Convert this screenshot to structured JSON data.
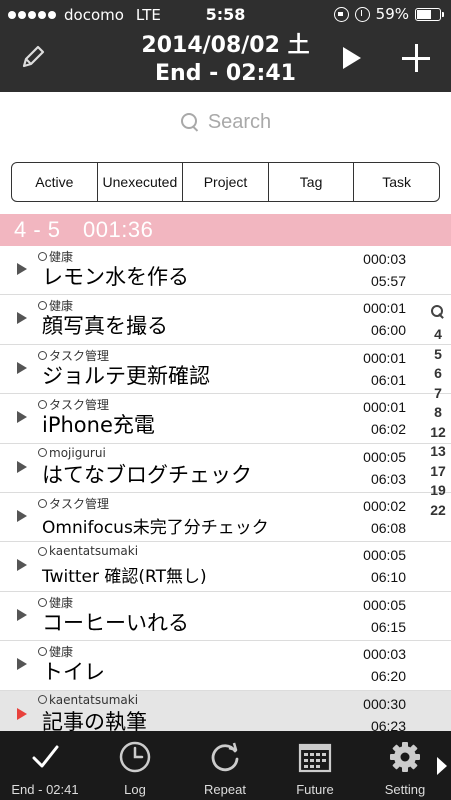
{
  "status_bar": {
    "carrier": "docomo",
    "network": "LTE",
    "time": "5:58",
    "battery_percent_label": "59%",
    "battery_level": 0.59,
    "icons": [
      "rotation-lock-icon",
      "alarm-icon",
      "battery-icon"
    ]
  },
  "header": {
    "date": "2014/08/02 土",
    "end_time": "End - 02:41",
    "left_icon": "pencil-icon",
    "play_icon": "play-icon",
    "add_icon": "plus-icon"
  },
  "search": {
    "placeholder": "Search",
    "icon": "search-icon"
  },
  "segments": {
    "items": [
      "Active",
      "Unexecuted",
      "Project",
      "Tag",
      "Task"
    ]
  },
  "section": {
    "title": "4 - 5　001:36",
    "color": "#f2b6c0"
  },
  "tasks": [
    {
      "project": "健康",
      "name": "レモン水を作る",
      "duration": "000:03",
      "start": "05:57"
    },
    {
      "project": "健康",
      "name": "顔写真を撮る",
      "duration": "000:01",
      "start": "06:00"
    },
    {
      "project": "タスク管理",
      "name": "ジョルテ更新確認",
      "duration": "000:01",
      "start": "06:01"
    },
    {
      "project": "タスク管理",
      "name": "iPhone充電",
      "duration": "000:01",
      "start": "06:02"
    },
    {
      "project": "mojigurui",
      "name": "はてなブログチェック",
      "duration": "000:05",
      "start": "06:03"
    },
    {
      "project": "タスク管理",
      "name": "Omnifocus未完了分チェック",
      "duration": "000:02",
      "start": "06:08"
    },
    {
      "project": "kaentatsumaki",
      "name": "Twitter 確認(RT無し)",
      "duration": "000:05",
      "start": "06:10"
    },
    {
      "project": "健康",
      "name": "コーヒーいれる",
      "duration": "000:05",
      "start": "06:15"
    },
    {
      "project": "健康",
      "name": "トイレ",
      "duration": "000:03",
      "start": "06:20"
    },
    {
      "project": "kaentatsumaki",
      "name": "記事の執筆",
      "duration": "000:30",
      "start": "06:23",
      "current": true
    }
  ],
  "index": {
    "icon": "search-icon",
    "items": [
      "4",
      "5",
      "6",
      "7",
      "8",
      "12",
      "13",
      "17",
      "19",
      "22"
    ]
  },
  "tabbar": {
    "tabs": [
      {
        "label": "End - 02:41",
        "icon": "checkmark-icon"
      },
      {
        "label": "Log",
        "icon": "clock-icon"
      },
      {
        "label": "Repeat",
        "icon": "repeat-icon"
      },
      {
        "label": "Future",
        "icon": "calendar-icon"
      },
      {
        "label": "Setting",
        "icon": "gear-icon"
      }
    ],
    "more_icon": "chevron-right-icon"
  },
  "colors": {
    "header_bg": "#2f2f2f",
    "tabbar_bg": "#1a1a1a",
    "current_arrow": "#e8413c",
    "current_row_bg": "#e5e5e5"
  }
}
